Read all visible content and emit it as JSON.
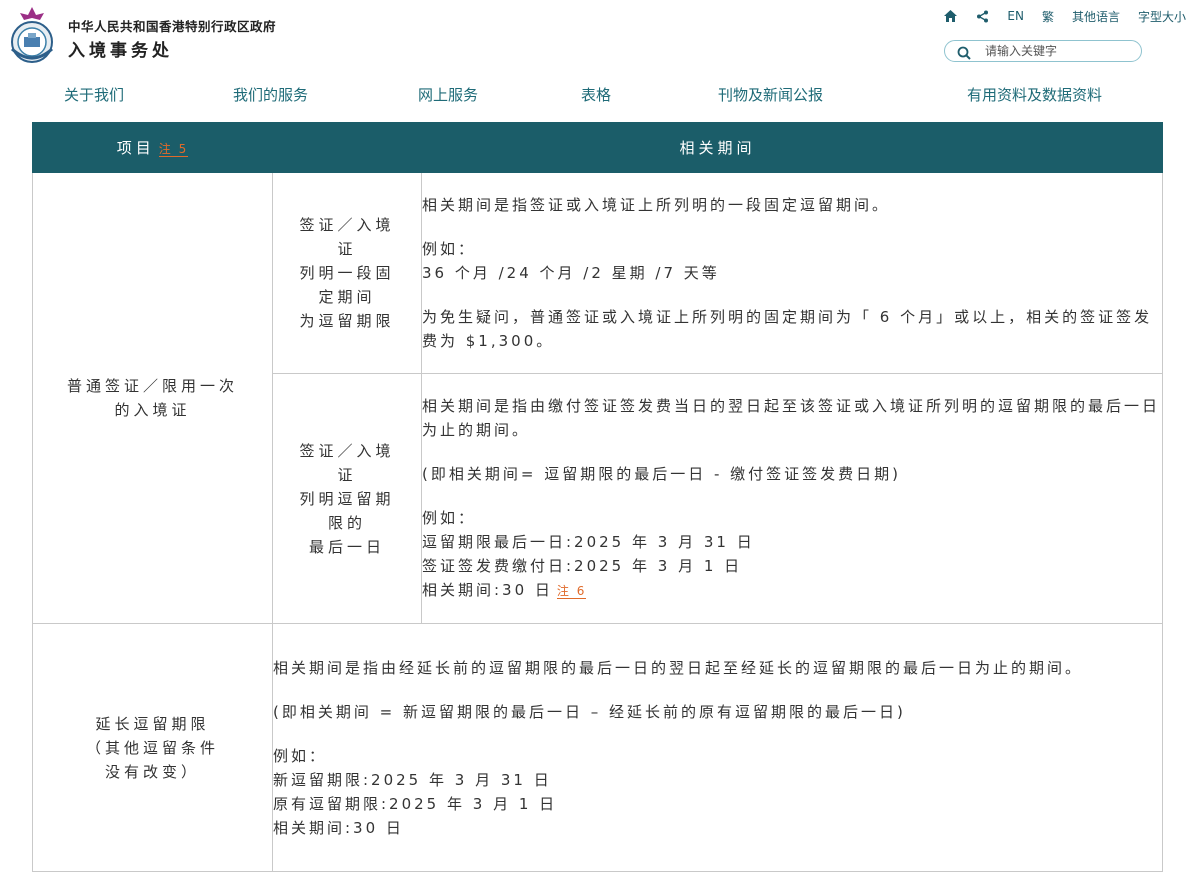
{
  "header": {
    "org_name": "中华人民共和国香港特别行政区政府",
    "dept_name": "入境事务处",
    "utility": {
      "lang_en": "EN",
      "lang_tc": "繁",
      "other_lang": "其他语言",
      "font_size": "字型大小"
    },
    "search": {
      "placeholder": "请输入关键字"
    }
  },
  "nav": {
    "items": [
      "关于我们",
      "我们的服务",
      "网上服务",
      "表格",
      "刊物及新闻公报",
      "有用资料及数据资料"
    ]
  },
  "table": {
    "headers": {
      "item": "项目",
      "item_note": "注 5",
      "period": "相关期间"
    },
    "rows": [
      {
        "category": [
          "普通签证／限用一次",
          "的入境证"
        ],
        "sub": [
          {
            "label": [
              "签证／入境",
              "证",
              "列明一段固",
              "定期间",
              "为逗留期限"
            ],
            "desc": {
              "p1": "相关期间是指签证或入境证上所列明的一段固定逗留期间。",
              "example_title": "例如：",
              "example_line": "36 个月 /24 个月 /2 星期 /7 天等",
              "p3": "为免生疑问，普通签证或入境证上所列明的固定期间为「 6 个月」或以上，相关的签证签发费为 $1,300。"
            }
          },
          {
            "label": [
              "签证／入境",
              "证",
              "列明逗留期",
              "限的",
              "最后一日"
            ],
            "desc": {
              "p1": "相关期间是指由缴付签证签发费当日的翌日起至该签证或入境证所列明的逗留期限的最后一日为止的期间。",
              "formula": "(即相关期间= 逗留期限的最后一日 - 缴付签证签发费日期)",
              "example_title": "例如：",
              "line1": "逗留期限最后一日:2025 年 3 月 31 日",
              "line2": "签证签发费缴付日:2025 年 3 月 1 日",
              "line3": "相关期间:30 日",
              "line3_note": "注 6"
            }
          }
        ]
      },
      {
        "category": [
          "延长逗留期限",
          "（其他逗留条件",
          "没有改变）"
        ],
        "desc": {
          "p1": "相关期间是指由经延长前的逗留期限的最后一日的翌日起至经延长的逗留期限的最后一日为止的期间。",
          "formula": "(即相关期间 = 新逗留期限的最后一日 – 经延长前的原有逗留期限的最后一日)",
          "example_title": "例如：",
          "line1": "新逗留期限:2025 年 3 月 31 日",
          "line2": "原有逗留期限:2025 年 3 月 1 日",
          "line3": "相关期间:30 日"
        }
      }
    ]
  },
  "colors": {
    "header_bg": "#1b5d69",
    "nav_text": "#1f6b78",
    "note": "#e06a2a",
    "border": "#c9c9c9"
  }
}
